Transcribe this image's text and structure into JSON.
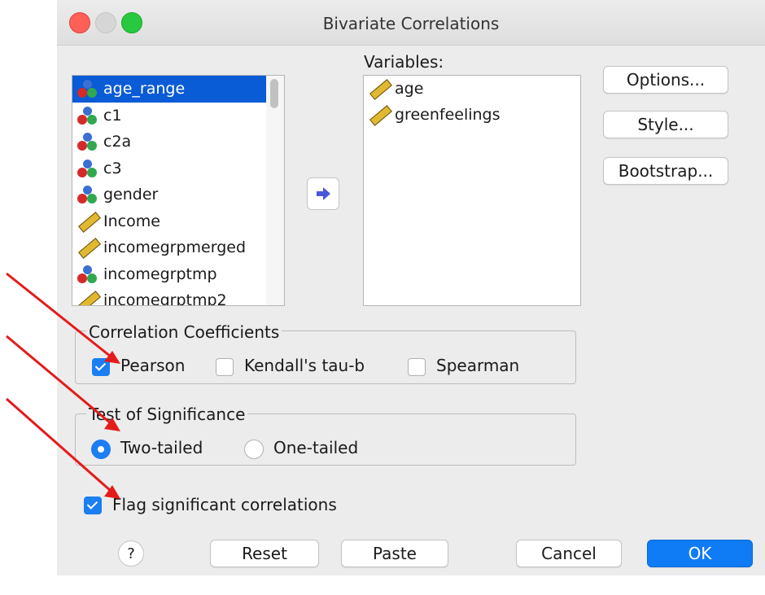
{
  "window": {
    "title": "Bivariate Correlations"
  },
  "source_list": {
    "items": [
      {
        "label": "age_range",
        "icon": "nominal-icon",
        "selected": true
      },
      {
        "label": "c1",
        "icon": "nominal-icon"
      },
      {
        "label": "c2a",
        "icon": "nominal-icon"
      },
      {
        "label": "c3",
        "icon": "nominal-icon"
      },
      {
        "label": "gender",
        "icon": "nominal-icon"
      },
      {
        "label": "Income",
        "icon": "scale-icon"
      },
      {
        "label": "incomegrpmerged",
        "icon": "scale-icon"
      },
      {
        "label": "incomegrptmp",
        "icon": "nominal-icon"
      },
      {
        "label": "incomegrptmp2",
        "icon": "scale-icon"
      }
    ]
  },
  "variables": {
    "label": "Variables:",
    "items": [
      {
        "label": "age",
        "icon": "scale-icon"
      },
      {
        "label": "greenfeelings",
        "icon": "scale-icon"
      }
    ]
  },
  "side_buttons": {
    "options": "Options...",
    "style": "Style...",
    "bootstrap": "Bootstrap..."
  },
  "coefficients": {
    "legend": "Correlation Coefficients",
    "pearson": {
      "label": "Pearson",
      "checked": true
    },
    "kendall": {
      "label": "Kendall's tau-b",
      "checked": false
    },
    "spearman": {
      "label": "Spearman",
      "checked": false
    }
  },
  "significance": {
    "legend": "Test of Significance",
    "two_tailed": {
      "label": "Two-tailed",
      "selected": true
    },
    "one_tailed": {
      "label": "One-tailed",
      "selected": false
    }
  },
  "flag": {
    "label": "Flag significant correlations",
    "checked": true
  },
  "footer": {
    "help": "?",
    "reset": "Reset",
    "paste": "Paste",
    "cancel": "Cancel",
    "ok": "OK"
  },
  "colors": {
    "accent": "#0f7cf5",
    "selection": "#0a5bd6",
    "annotation_arrow": "#e41b1b"
  }
}
